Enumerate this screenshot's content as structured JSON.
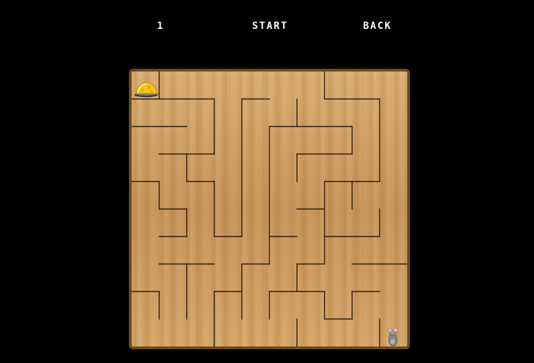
{
  "hud": {
    "level": "1",
    "start_label": "START",
    "back_label": "BACK"
  },
  "maze": {
    "grid_size": 10,
    "walls": [
      [
        0,
        1,
        2,
        1
      ],
      [
        1,
        0,
        1,
        1
      ],
      [
        2,
        1,
        3,
        1
      ],
      [
        3,
        1,
        3,
        3
      ],
      [
        0,
        2,
        2,
        2
      ],
      [
        1,
        3,
        3,
        3
      ],
      [
        2,
        3,
        2,
        4
      ],
      [
        0,
        4,
        1,
        4
      ],
      [
        1,
        4,
        1,
        5
      ],
      [
        2,
        4,
        3,
        4
      ],
      [
        3,
        4,
        3,
        6
      ],
      [
        1,
        5,
        2,
        5
      ],
      [
        2,
        5,
        2,
        6
      ],
      [
        1,
        6,
        2,
        6
      ],
      [
        3,
        6,
        4,
        6
      ],
      [
        4,
        1,
        4,
        6
      ],
      [
        4,
        1,
        5,
        1
      ],
      [
        5,
        2,
        5,
        7
      ],
      [
        1,
        7,
        3,
        7
      ],
      [
        4,
        7,
        5,
        7
      ],
      [
        4,
        7,
        4,
        9
      ],
      [
        5,
        2,
        8,
        2
      ],
      [
        6,
        1,
        6,
        2
      ],
      [
        7,
        0,
        7,
        1
      ],
      [
        7,
        1,
        9,
        1
      ],
      [
        9,
        1,
        9,
        4
      ],
      [
        6,
        3,
        8,
        3
      ],
      [
        8,
        2,
        8,
        3
      ],
      [
        6,
        3,
        6,
        4
      ],
      [
        7,
        4,
        9,
        4
      ],
      [
        7,
        4,
        7,
        7
      ],
      [
        8,
        4,
        8,
        5
      ],
      [
        6,
        5,
        7,
        5
      ],
      [
        7,
        6,
        9,
        6
      ],
      [
        9,
        5,
        9,
        6
      ],
      [
        5,
        6,
        6,
        6
      ],
      [
        6,
        7,
        7,
        7
      ],
      [
        6,
        7,
        6,
        8
      ],
      [
        8,
        7,
        10,
        7
      ],
      [
        2,
        7,
        2,
        9
      ],
      [
        0,
        8,
        1,
        8
      ],
      [
        1,
        8,
        1,
        9
      ],
      [
        3,
        8,
        4,
        8
      ],
      [
        3,
        8,
        3,
        10
      ],
      [
        5,
        8,
        7,
        8
      ],
      [
        5,
        8,
        5,
        9
      ],
      [
        7,
        8,
        7,
        9
      ],
      [
        7,
        9,
        8,
        9
      ],
      [
        8,
        8,
        9,
        8
      ],
      [
        8,
        8,
        8,
        9
      ],
      [
        9,
        9,
        9,
        10
      ],
      [
        6,
        9,
        6,
        10
      ]
    ]
  },
  "items": {
    "goal": "cheese-icon",
    "player": "mouse-icon"
  },
  "colors": {
    "background": "#000000",
    "text": "#ffffff",
    "board_border": "#6b4a1c",
    "wood": "#c99a5f",
    "wall": "#2a1a0c",
    "cheese": "#f5c518"
  }
}
